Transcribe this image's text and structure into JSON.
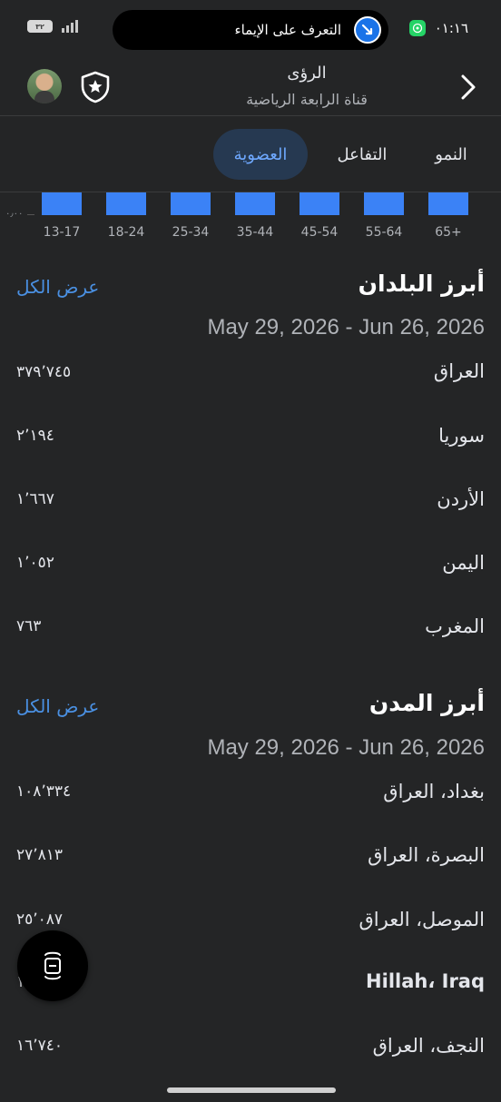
{
  "status_bar": {
    "battery": "٣٢",
    "battery_level": 0.32,
    "island_text": "التعرف على الإيماء",
    "time": "٠١:١٦"
  },
  "header": {
    "title": "الرؤى",
    "subtitle": "قناة الرابعة الرياضية"
  },
  "tabs": [
    {
      "label": "النمو",
      "active": false
    },
    {
      "label": "التفاعل",
      "active": false
    },
    {
      "label": "العضوية",
      "active": true
    }
  ],
  "age_chart": {
    "axis_tick": "٠٫٠٠",
    "bar_color": "#3b82f6",
    "groups": [
      "13-17",
      "18-24",
      "25-34",
      "35-44",
      "45-54",
      "55-64",
      "65+"
    ]
  },
  "top_countries": {
    "title": "أبرز البلدان",
    "see_all": "عرض الكل",
    "date_range": "May 29, 2026 - Jun 26, 2026",
    "rows": [
      {
        "name": "العراق",
        "value": "٣٧٩٬٧٤٥"
      },
      {
        "name": "سوريا",
        "value": "٢٬١٩٤"
      },
      {
        "name": "الأردن",
        "value": "١٬٦٦٧"
      },
      {
        "name": "اليمن",
        "value": "١٬٠٥٢"
      },
      {
        "name": "المغرب",
        "value": "٧٦٣"
      }
    ]
  },
  "top_cities": {
    "title": "أبرز المدن",
    "see_all": "عرض الكل",
    "date_range": "May 29, 2026 - Jun 26, 2026",
    "rows": [
      {
        "name": "بغداد، العراق",
        "value": "١٠٨٬٣٣٤"
      },
      {
        "name": "البصرة، العراق",
        "value": "٢٧٬٨١٣"
      },
      {
        "name": "الموصل، العراق",
        "value": "٢٥٬٠٨٧"
      },
      {
        "name": "Hillah، Iraq",
        "value": "١٧..."
      },
      {
        "name": "النجف، العراق",
        "value": "١٦٬٧٤٠"
      }
    ]
  },
  "colors": {
    "background": "#242526",
    "accent": "#4a90e2",
    "active_tab_bg": "#263951"
  }
}
